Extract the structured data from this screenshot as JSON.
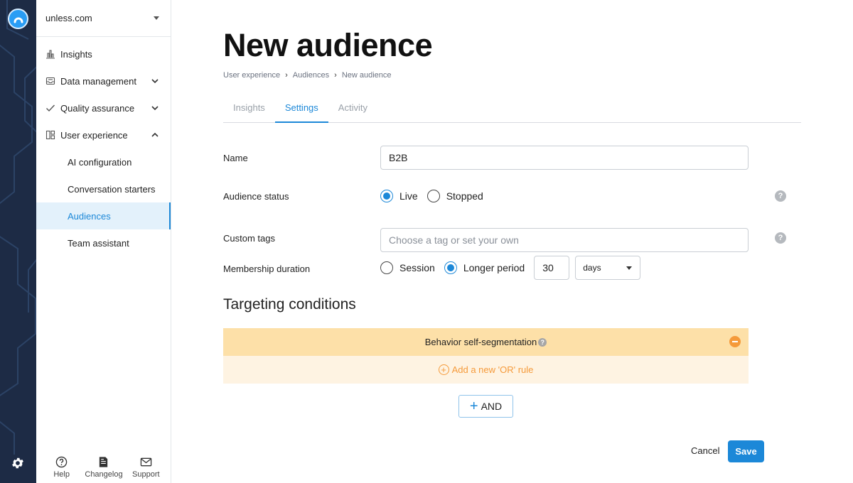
{
  "sidebar": {
    "org": "unless.com",
    "items": [
      {
        "label": "Insights",
        "icon": "bar-chart-icon"
      },
      {
        "label": "Data management",
        "icon": "inbox-icon"
      },
      {
        "label": "Quality assurance",
        "icon": "checkmark-icon"
      },
      {
        "label": "User experience",
        "icon": "layout-icon"
      }
    ],
    "sub_items": [
      {
        "label": "AI configuration",
        "active": false
      },
      {
        "label": "Conversation starters",
        "active": false
      },
      {
        "label": "Audiences",
        "active": true
      },
      {
        "label": "Team assistant",
        "active": false
      }
    ],
    "footer": [
      {
        "label": "Help",
        "icon": "help-icon"
      },
      {
        "label": "Changelog",
        "icon": "changelog-icon"
      },
      {
        "label": "Support",
        "icon": "mail-icon"
      }
    ]
  },
  "page": {
    "title": "New audience",
    "breadcrumbs": [
      "User experience",
      "Audiences",
      "New audience"
    ],
    "tabs": [
      {
        "label": "Insights",
        "active": false
      },
      {
        "label": "Settings",
        "active": true
      },
      {
        "label": "Activity",
        "active": false
      }
    ]
  },
  "form": {
    "name_label": "Name",
    "name_value": "B2B",
    "status_label": "Audience status",
    "status_options": [
      "Live",
      "Stopped"
    ],
    "status_selected": "Live",
    "tags_label": "Custom tags",
    "tags_placeholder": "Choose a tag or set your own",
    "duration_label": "Membership duration",
    "duration_options": [
      "Session",
      "Longer period"
    ],
    "duration_selected": "Longer period",
    "duration_value": "30",
    "duration_unit": "days",
    "help_glyph": "?"
  },
  "targeting": {
    "title": "Targeting conditions",
    "condition_label": "Behavior self-segmentation",
    "add_or_label": "Add a new 'OR' rule",
    "and_label": "AND"
  },
  "actions": {
    "cancel_label": "Cancel",
    "save_label": "Save"
  },
  "colors": {
    "accent": "#1c88d8",
    "rail": "#1d2b45",
    "condition_header": "#fde0a8",
    "condition_body": "#fef3e2",
    "orange": "#f59a3a"
  }
}
